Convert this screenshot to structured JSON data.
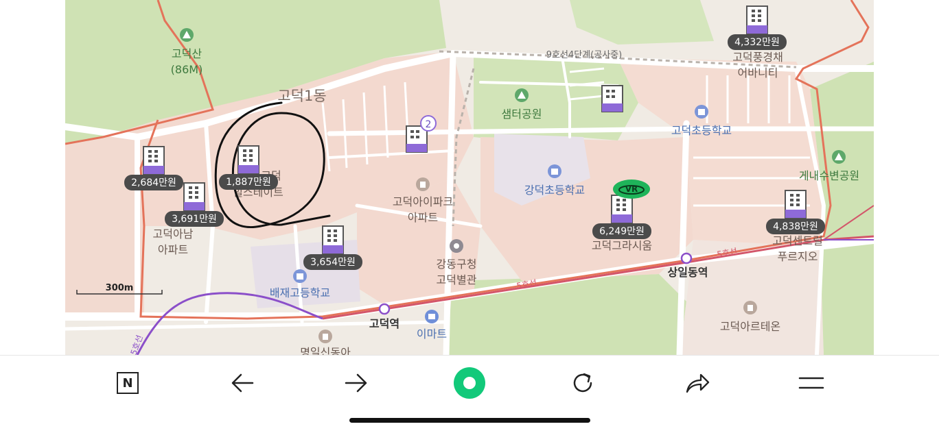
{
  "map": {
    "districts": {
      "godeok1": "고덕1동"
    },
    "mountain": {
      "name": "고덕산",
      "height": "(86M)"
    },
    "places": {
      "samter_park": "샘터공원",
      "godeok_elem": "고덕초등학교",
      "gangdeok_elem": "강덕초등학교",
      "gaenae_park": "게내수변공원",
      "baejae_high": "배재고등학교",
      "gangdong_office_1": "강동구청",
      "gangdong_office_2": "고덕별관",
      "emart": "이마트",
      "godeok_arteon": "고덕아르테온",
      "myeongil": "명일신동아",
      "godeok_ipark_1": "고덕아이파크",
      "godeok_ipark_2": "아파트",
      "godeok_anam_1": "고덕아남",
      "godeok_anam_2": "아파트",
      "hillstate_1": "고덕",
      "hillstate_2": "힐스테이트",
      "gracium": "고덕그라시움",
      "centreville_1": "고덕센트럴",
      "centreville_2": "푸르지오",
      "pungkyung_1": "고덕풍경채",
      "pungkyung_2": "어바니티"
    },
    "stations": {
      "godeok": "고덕역",
      "sangil": "상일동역"
    },
    "lines": {
      "line5_a": "5호선",
      "line5_b": "5호선",
      "line9": "9호선4단계(공사중)",
      "line_left": "5호선"
    },
    "scale": "300m",
    "vr_badge": "VR",
    "cluster_count": "2",
    "prices": [
      "2,684만원",
      "1,887만원",
      "3,691만원",
      "3,654만원",
      "6,249만원",
      "4,838만원",
      "4,332만원"
    ],
    "colors": {
      "residential": "#f3d9cf",
      "park": "#cfe2b4",
      "road": "#ffffff",
      "boundary": "#e4735a",
      "line5": "#d3566a",
      "line_purple": "#8b4fc9",
      "price_badge": "#4b4b4b",
      "marker_purple": "#8e6ad8",
      "vr_green": "#1fb45a"
    }
  },
  "toolbar": {
    "items": [
      "naver-n-icon",
      "back-arrow-icon",
      "forward-arrow-icon",
      "green-home-icon",
      "refresh-icon",
      "share-icon",
      "menu-icon"
    ],
    "n_label": "N"
  }
}
